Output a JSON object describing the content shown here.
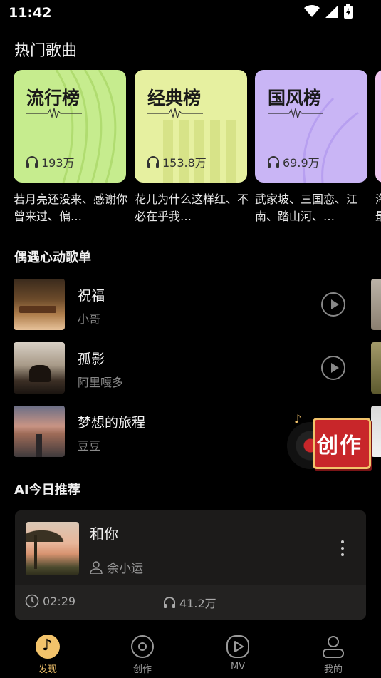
{
  "status_bar": {
    "time": "11:42"
  },
  "hot_songs": {
    "title": "热门歌曲",
    "cards": [
      {
        "name": "流行榜",
        "plays": "193万",
        "desc": "若月亮还没来、感谢你曾来过、偏…",
        "color": "#c6ec8e"
      },
      {
        "name": "经典榜",
        "plays": "153.8万",
        "desc": "花儿为什么这样红、不必在乎我…",
        "color": "#e6f0a0"
      },
      {
        "name": "国风榜",
        "plays": "69.9万",
        "desc": "武家坡、三国恋、江南、踏山河、…",
        "color": "#c9b5f5"
      },
      {
        "name": "",
        "plays": "",
        "desc": "海最",
        "color": "#f3c7f0"
      }
    ]
  },
  "playlist": {
    "title": "偶遇心动歌单",
    "songs": [
      {
        "title": "祝福",
        "artist": "小哥"
      },
      {
        "title": "孤影",
        "artist": "阿里嘎多"
      },
      {
        "title": "梦想的旅程",
        "artist": "豆豆"
      }
    ]
  },
  "floating_badge": {
    "label": "创作"
  },
  "ai_recommend": {
    "title": "AI今日推荐",
    "song": {
      "title": "和你",
      "artist": "余小运",
      "duration": "02:29",
      "plays": "41.2万"
    }
  },
  "nav": {
    "items": [
      {
        "label": "发现",
        "active": true
      },
      {
        "label": "创作",
        "active": false
      },
      {
        "label": "MV",
        "active": false
      },
      {
        "label": "我的",
        "active": false
      }
    ]
  },
  "colors": {
    "active_nav": "#f2c36b",
    "badge_red": "#c8262a"
  }
}
